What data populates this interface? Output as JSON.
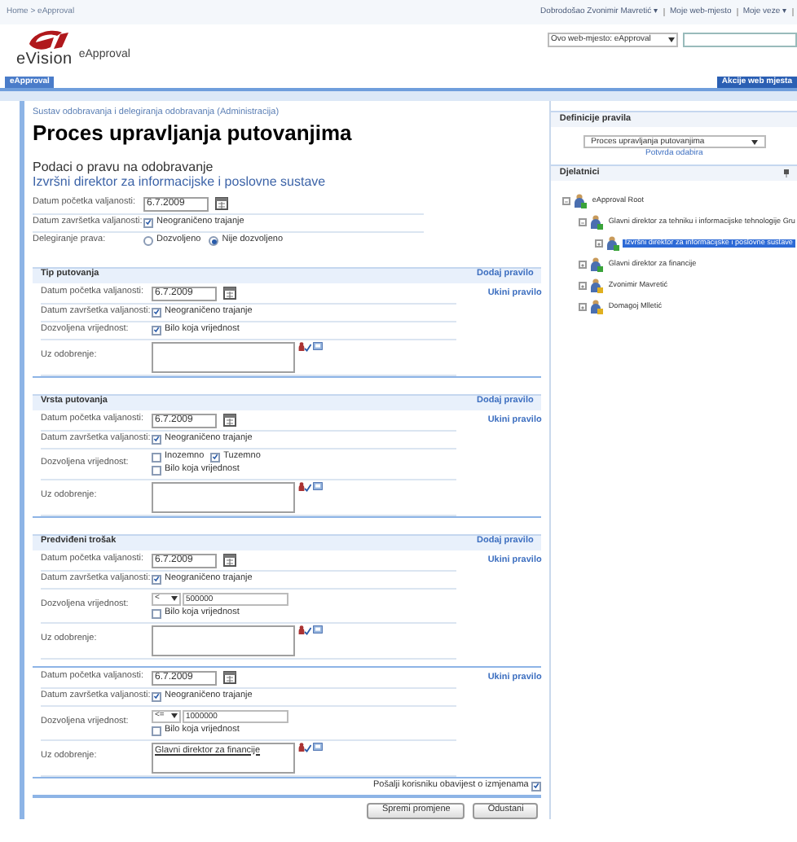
{
  "top_bar": {
    "breadcrumb": "Home > eApproval",
    "welcome": "Dobrodošao Zvonimir Mavretić ▾",
    "links": [
      "Moje web-mjesto",
      "Moje veze ▾"
    ]
  },
  "header": {
    "logo_text": "eVision",
    "site_title": "eApproval",
    "search_scope": "Ovo web-mjesto: eApproval"
  },
  "tabs": [
    {
      "label": "eApproval",
      "selected": true
    }
  ],
  "site_actions": "Akcije web mjesta",
  "page": {
    "breadcrumb": "Sustav odobravanja i delegiranja odobravanja (Administracija)",
    "title": "Proces upravljanja putovanjima",
    "subheading": "Podaci o pravu na odobravanje",
    "role": "Izvršni direktor za informacijske i poslovne sustave",
    "start_label": "Datum početka valjanosti:",
    "start_date": "6.7.2009",
    "end_label": "Datum završetka valjanosti:",
    "unlimited": {
      "label": "Neograničeno trajanje",
      "checked": true
    },
    "delegation_label": "Delegiranje prava:",
    "delegation_options": [
      {
        "label": "Dozvoljeno",
        "selected": false
      },
      {
        "label": "Nije dozvoljeno",
        "selected": true
      }
    ]
  },
  "sections": [
    {
      "title": "Tip putovanja",
      "add_link": "Dodaj pravilo",
      "rules": [
        {
          "remove_link": "Ukini pravilo",
          "start_label": "Datum početka valjanosti:",
          "start_date": "6.7.2009",
          "end_label": "Datum završetka valjanosti:",
          "unlimited": {
            "label": "Neograničeno trajanje",
            "checked": true
          },
          "allowed_label": "Dozvoljena vrijednost:",
          "allowed": {
            "kind": "any",
            "any": {
              "label": "Bilo koja vrijednost",
              "checked": true
            }
          },
          "approval_label": "Uz odobrenje:"
        }
      ]
    },
    {
      "title": "Vrsta putovanja",
      "add_link": "Dodaj pravilo",
      "rules": [
        {
          "remove_link": "Ukini pravilo",
          "start_label": "Datum početka valjanosti:",
          "start_date": "6.7.2009",
          "end_label": "Datum završetka valjanosti:",
          "unlimited": {
            "label": "Neograničeno trajanje",
            "checked": true
          },
          "allowed_label": "Dozvoljena vrijednost:",
          "allowed": {
            "kind": "options",
            "options": [
              {
                "label": "Inozemno",
                "checked": false
              },
              {
                "label": "Tuzemno",
                "checked": true
              }
            ],
            "any": {
              "label": "Bilo koja vrijednost",
              "checked": false
            }
          },
          "approval_label": "Uz odobrenje:"
        }
      ]
    },
    {
      "title": "Predviđeni trošak",
      "add_link": "Dodaj pravilo",
      "rules": [
        {
          "remove_link": "Ukini pravilo",
          "start_label": "Datum početka valjanosti:",
          "start_date": "6.7.2009",
          "end_label": "Datum završetka valjanosti:",
          "unlimited": {
            "label": "Neograničeno trajanje",
            "checked": true
          },
          "allowed_label": "Dozvoljena vrijednost:",
          "allowed": {
            "kind": "amount",
            "operator": "<",
            "amount": "500000",
            "any": {
              "label": "Bilo koja vrijednost",
              "checked": false
            }
          },
          "approval_label": "Uz odobrenje:"
        },
        {
          "remove_link": "Ukini pravilo",
          "start_label": "Datum početka valjanosti:",
          "start_date": "6.7.2009",
          "end_label": "Datum završetka valjanosti:",
          "unlimited": {
            "label": "Neograničeno trajanje",
            "checked": true
          },
          "allowed_label": "Dozvoljena vrijednost:",
          "allowed": {
            "kind": "amount",
            "operator": "<=",
            "amount": "1000000",
            "any": {
              "label": "Bilo koja vrijednost",
              "checked": false
            }
          },
          "approval_label": "Uz odobrenje:",
          "approver": "Glavni direktor za financije"
        }
      ]
    }
  ],
  "notify": {
    "label": "Pošalji korisniku obavijest o izmjenama",
    "checked": true
  },
  "buttons": [
    "Spremi promjene",
    "Odustani"
  ],
  "sidebar": {
    "definitions_title": "Definicije pravila",
    "process_select": "Proces upravljanja putovanjima",
    "confirm_link": "Potvrda odabira",
    "workers_title": "Djelatnici",
    "tree": [
      {
        "label": "eApproval Root",
        "selected": false,
        "expanded": true,
        "color": "#3aa33a",
        "children": [
          {
            "label": "Glavni direktor za tehniku i informacijske tehnologije Gru",
            "selected": false,
            "expanded": true,
            "color": "#3aa33a",
            "children": [
              {
                "label": "Izvršni direktor za informacijske i poslovne sustave",
                "selected": true,
                "expanded": false,
                "color": "#3aa33a"
              }
            ]
          },
          {
            "label": "Glavni direktor za financije",
            "selected": false,
            "expanded": false,
            "color": "#3aa33a"
          },
          {
            "label": "Zvonimir Mavretić",
            "selected": false,
            "expanded": false,
            "color": "#e0b020"
          },
          {
            "label": "Domagoj Mlletić",
            "selected": false,
            "expanded": false,
            "color": "#e0b020"
          }
        ]
      }
    ]
  }
}
